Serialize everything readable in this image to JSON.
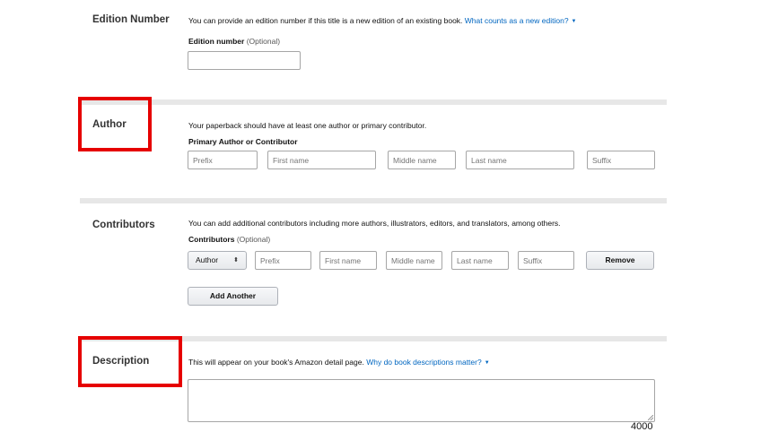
{
  "edition": {
    "title": "Edition Number",
    "help_text": "You can provide an edition number if this title is a new edition of an existing book.",
    "help_link": "What counts as a new edition?",
    "field_label": "Edition number",
    "field_optional": "(Optional)",
    "field_value": ""
  },
  "author": {
    "title": "Author",
    "help_text": "Your paperback should have at least one author or primary contributor.",
    "field_label": "Primary Author or Contributor",
    "placeholders": {
      "prefix": "Prefix",
      "first_name": "First name",
      "middle_name": "Middle name",
      "last_name": "Last name",
      "suffix": "Suffix"
    }
  },
  "contributors": {
    "title": "Contributors",
    "help_text": "You can add additional contributors including more authors, illustrators, editors, and translators, among others.",
    "field_label": "Contributors",
    "field_optional": "(Optional)",
    "role_value": "Author",
    "role_arrow": "⬍",
    "placeholders": {
      "prefix": "Prefix",
      "first_name": "First name",
      "middle_name": "Middle name",
      "last_name": "Last name",
      "suffix": "Suffix"
    },
    "remove_label": "Remove",
    "add_another_label": "Add Another"
  },
  "description": {
    "title": "Description",
    "help_text": "This will appear on your book's Amazon detail page.",
    "help_link": "Why do book descriptions matter?",
    "char_count": "4000"
  },
  "icons": {
    "caret": "caret-down-icon",
    "resize": "resize-handle-icon"
  },
  "highlight_color": "#e60000"
}
